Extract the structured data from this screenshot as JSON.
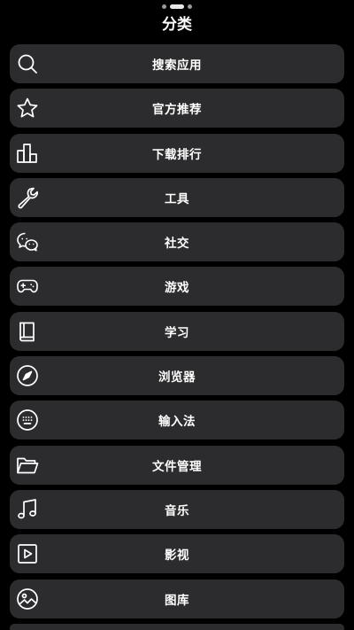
{
  "header": {
    "title": "分类"
  },
  "colors": {
    "background": "#000000",
    "row": "#2c2c2e",
    "text": "#ffffff"
  },
  "categories": [
    {
      "label": "搜索应用",
      "icon": "search-icon"
    },
    {
      "label": "官方推荐",
      "icon": "star-icon"
    },
    {
      "label": "下载排行",
      "icon": "bar-chart-icon"
    },
    {
      "label": "工具",
      "icon": "wrench-icon"
    },
    {
      "label": "社交",
      "icon": "chat-bubbles-icon"
    },
    {
      "label": "游戏",
      "icon": "gamepad-icon"
    },
    {
      "label": "学习",
      "icon": "book-icon"
    },
    {
      "label": "浏览器",
      "icon": "compass-icon"
    },
    {
      "label": "输入法",
      "icon": "keyboard-icon"
    },
    {
      "label": "文件管理",
      "icon": "folder-icon"
    },
    {
      "label": "音乐",
      "icon": "music-note-icon"
    },
    {
      "label": "影视",
      "icon": "video-play-icon"
    },
    {
      "label": "图库",
      "icon": "gallery-icon"
    }
  ]
}
